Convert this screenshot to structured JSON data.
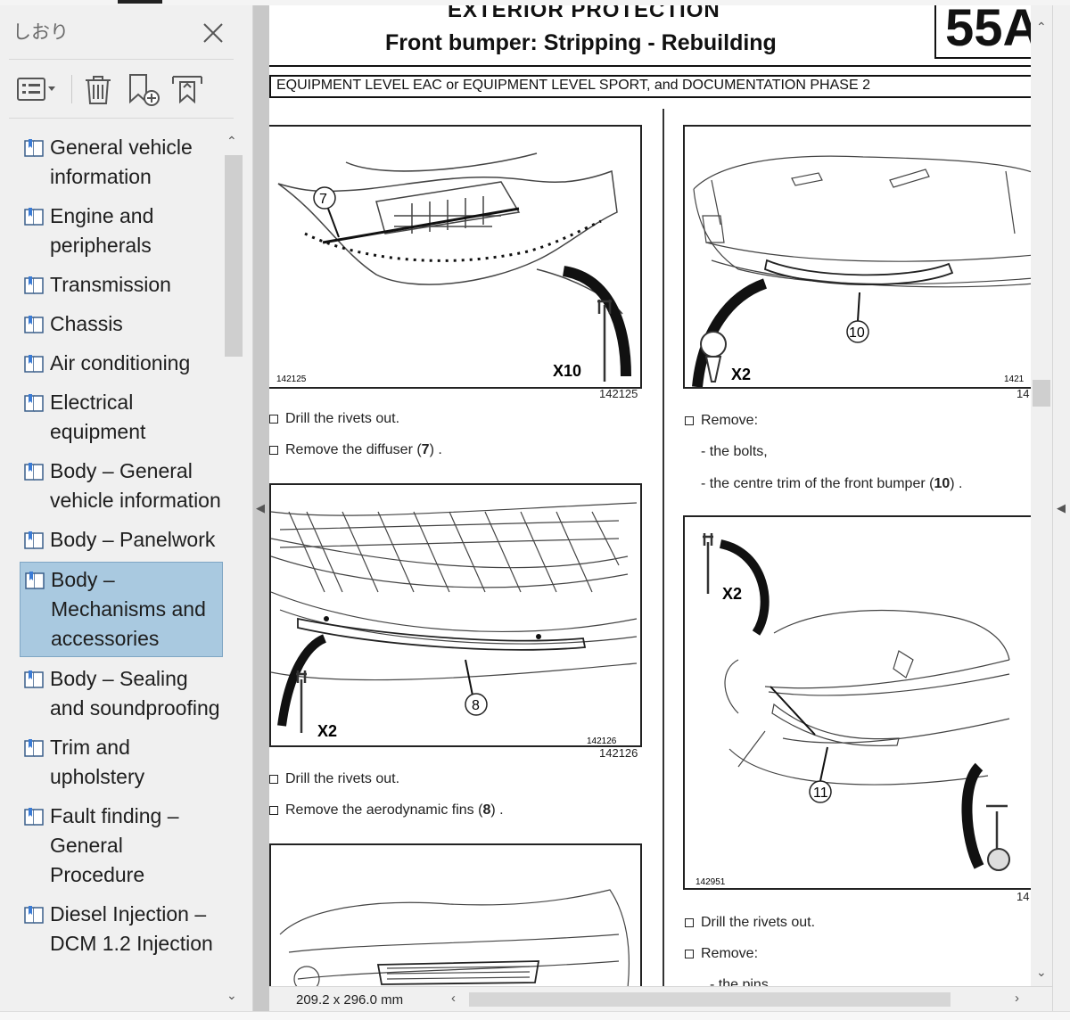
{
  "sidebar": {
    "title": "しおり",
    "items": [
      {
        "label": "General vehicle information"
      },
      {
        "label": "Engine and peripherals"
      },
      {
        "label": "Transmission"
      },
      {
        "label": "Chassis"
      },
      {
        "label": "Air conditioning"
      },
      {
        "label": "Electrical equipment"
      },
      {
        "label": "Body – General vehicle information"
      },
      {
        "label": "Body – Panelwork"
      },
      {
        "label": "Body – Mechanisms and accessories"
      },
      {
        "label": "Body – Sealing and soundproofing"
      },
      {
        "label": "Trim and upholstery"
      },
      {
        "label": "Fault finding – General Procedure"
      },
      {
        "label": "Diesel Injection – DCM 1.2 Injection"
      }
    ]
  },
  "document": {
    "header_top": "EXTERIOR PROTECTION",
    "title": "Front bumper: Stripping - Rebuilding",
    "section": "55A",
    "equipment": "EQUIPMENT LEVEL EAC or EQUIPMENT LEVEL SPORT, and DOCUMENTATION PHASE 2",
    "fig1": {
      "ref": "142125",
      "small_ref": "142125",
      "callout": "7",
      "qty": "X10"
    },
    "fig2": {
      "ref": "142126",
      "small_ref": "142126",
      "callout": "8",
      "qty": "X2"
    },
    "fig4": {
      "ref": "14",
      "small_ref": "1421",
      "callout": "10",
      "qty": "X2"
    },
    "fig5": {
      "ref": "14",
      "small_ref": "142951",
      "callout": "11",
      "qty": "X2"
    },
    "left_steps": [
      {
        "text": "Drill the rivets out."
      },
      {
        "text": "Remove the diffuser (",
        "bold": "7",
        "end": ") ."
      },
      {
        "text": "Drill the rivets out."
      },
      {
        "text": "Remove the aerodynamic fins (",
        "bold": "8",
        "end": ") ."
      }
    ],
    "right_steps": {
      "remove1": "Remove:",
      "bolts": "- the bolts,",
      "trim_text": "- the centre trim of the front bumper (",
      "trim_bold": "10",
      "trim_end": ") .",
      "drill": "Drill the rivets out.",
      "remove2": "Remove:",
      "pins": "- the pins"
    }
  },
  "status": {
    "dimensions": "209.2 x 296.0 mm"
  }
}
